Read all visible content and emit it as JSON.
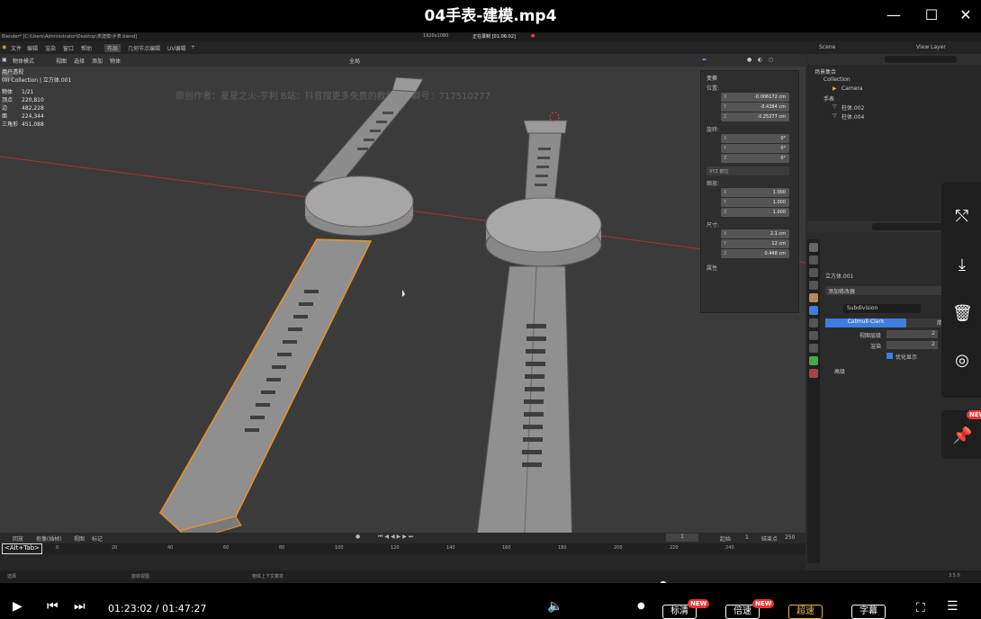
{
  "player": {
    "title": "04手表-建模.mp4",
    "time_text": "01:23:02 / 01:47:27",
    "btn_labels": [
      "标清",
      "倍速",
      "超速",
      "字幕"
    ],
    "new_badge": "NEW"
  },
  "blender": {
    "topbar": {
      "app": "Blender* [C:\\Users\\Administrator\\Desktop\\表建模\\手表.blend]",
      "resolution": "1920x1080",
      "recording": "正在录制 [01:06:02]"
    },
    "menus": [
      "文件",
      "编辑",
      "渲染",
      "窗口",
      "帮助"
    ],
    "workspace_tabs": [
      "布局",
      "几何节点编辑",
      "UV编辑"
    ],
    "scene": "Scene",
    "view_layer": "View Layer",
    "viewport": {
      "mode": "物体模式",
      "menus": [
        "视图",
        "选择",
        "添加",
        "物体"
      ],
      "transform_orientation": "全局",
      "view_label": "用户透视",
      "collection_line": "(0) Collection | 立方体.001",
      "stats": [
        {
          "k": "物体",
          "v": "1/21"
        },
        {
          "k": "顶点",
          "v": "220,810"
        },
        {
          "k": "边",
          "v": "482,228"
        },
        {
          "k": "面",
          "v": "224,344"
        },
        {
          "k": "三角形",
          "v": "451,088"
        }
      ],
      "watermark": "原创作者：星星之火-亨利      B站：抖音搜更多免费的教程      QQ群号：717510277"
    },
    "npanel": {
      "section": "变换",
      "location_label": "位置:",
      "location": [
        "-0.006172 cm",
        "-8.4384 cm",
        "-0.25277 cm"
      ],
      "rotation_label": "旋转:",
      "rotation": [
        "0°",
        "0°",
        "0°"
      ],
      "rotation_mode": "XYZ 欧拉",
      "scale_label": "缩放:",
      "scale": [
        "1.000",
        "1.000",
        "1.000"
      ],
      "dimensions_label": "尺寸:",
      "dimensions": [
        "2.1 cm",
        "12 cm",
        "0.448 cm"
      ],
      "attributes": "属性"
    },
    "outliner": {
      "root": "场景集合",
      "items": [
        "Collection",
        "Camera",
        "手表",
        "柱体.002",
        "柱体.004"
      ]
    },
    "properties": {
      "object_name": "立方体.001",
      "add_modifier": "添加修改器",
      "modifier_name": "Subdivision",
      "tabs": [
        "Catmull-Clark",
        "简单"
      ],
      "levels_viewport_label": "视图层级",
      "levels_viewport": "2",
      "render_label": "渲染",
      "render": "2",
      "optimal_label": "优化显示",
      "advanced": "高级"
    },
    "timeline": {
      "menus": [
        "回放",
        "抠像(插帧)",
        "视图",
        "标记"
      ],
      "current_frame": "1",
      "start_label": "起始",
      "start": "1",
      "end_label": "结束点",
      "end": "250",
      "ticks": [
        "0",
        "20",
        "40",
        "60",
        "80",
        "100",
        "120",
        "140",
        "160",
        "180",
        "200",
        "220",
        "240"
      ],
      "alt_tab": "<Alt+Tab>"
    },
    "statusbar": {
      "left": "选择",
      "mid1": "旋转视图",
      "mid2": "物体上下文菜单",
      "right": "3.5.0"
    }
  },
  "colors": {
    "accent": "#29a8ff",
    "selection_outline": "#e8932a",
    "badge": "#e33333"
  }
}
